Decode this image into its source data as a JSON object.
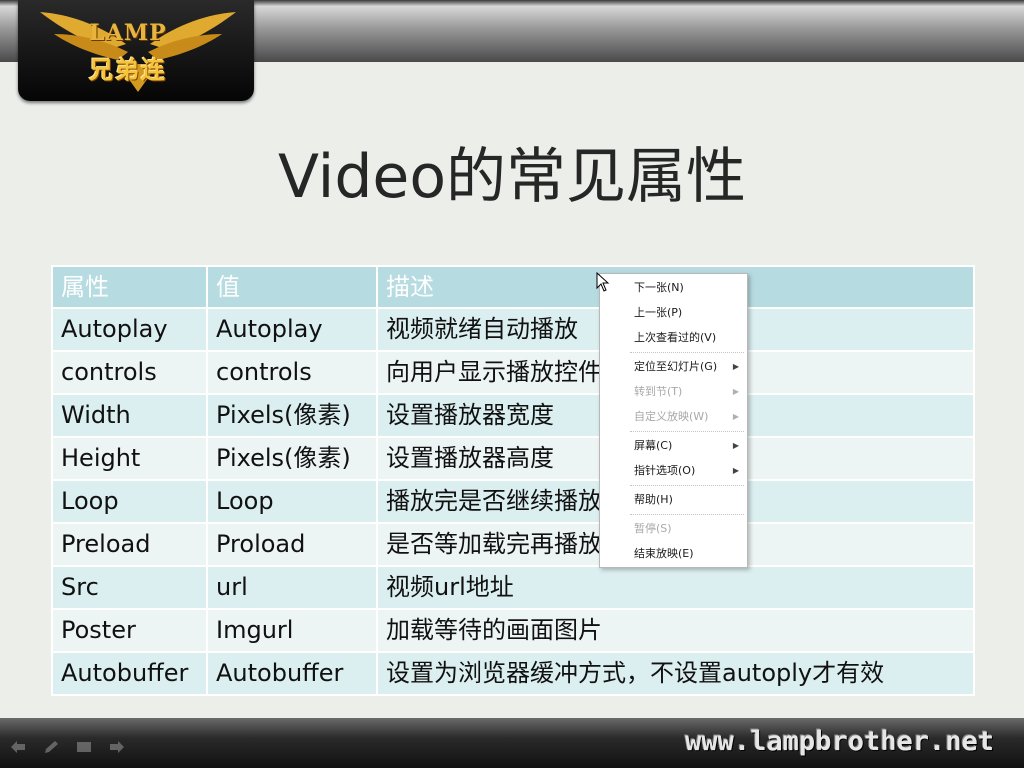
{
  "logo": {
    "english_text": "LAMP",
    "chinese_text": "兄弟连"
  },
  "slide": {
    "title": "Video的常见属性"
  },
  "table": {
    "headers": [
      "属性",
      "值",
      "描述"
    ],
    "rows": [
      [
        "Autoplay",
        "Autoplay",
        "视频就绪自动播放"
      ],
      [
        "controls",
        "controls",
        "向用户显示播放控件"
      ],
      [
        "Width",
        "Pixels(像素)",
        "设置播放器宽度"
      ],
      [
        "Height",
        "Pixels(像素)",
        "设置播放器高度"
      ],
      [
        "Loop",
        "Loop",
        "播放完是否继续播放，循环播放"
      ],
      [
        "Preload",
        "Proload",
        "是否等加载完再播放"
      ],
      [
        "Src",
        "url",
        "视频url地址"
      ],
      [
        "Poster",
        "Imgurl",
        "加载等待的画面图片"
      ],
      [
        "Autobuffer",
        "Autobuffer",
        "设置为浏览器缓冲方式，不设置autoply才有效"
      ]
    ]
  },
  "context_menu": {
    "items": [
      {
        "label": "下一张(N)",
        "enabled": true,
        "submenu": false
      },
      {
        "label": "上一张(P)",
        "enabled": true,
        "submenu": false
      },
      {
        "label": "上次查看过的(V)",
        "enabled": true,
        "submenu": false
      },
      {
        "label": "定位至幻灯片(G)",
        "enabled": true,
        "submenu": true
      },
      {
        "label": "转到节(T)",
        "enabled": false,
        "submenu": true
      },
      {
        "label": "自定义放映(W)",
        "enabled": false,
        "submenu": true
      },
      {
        "label": "屏幕(C)",
        "enabled": true,
        "submenu": true
      },
      {
        "label": "指针选项(O)",
        "enabled": true,
        "submenu": true
      },
      {
        "label": "帮助(H)",
        "enabled": true,
        "submenu": false
      },
      {
        "label": "暂停(S)",
        "enabled": false,
        "submenu": false
      },
      {
        "label": "结束放映(E)",
        "enabled": true,
        "submenu": false
      }
    ]
  },
  "footer": {
    "website": "www.lampbrother.net",
    "controls": [
      "prev-arrow-icon",
      "pen-icon",
      "menu-icon",
      "next-arrow-icon"
    ]
  },
  "colors": {
    "header_row": "#b6dbe0",
    "row_odd": "#dbeef0",
    "row_even": "#edf4f4",
    "logo_gold": "#f4c43c",
    "background": "#eceeea"
  }
}
